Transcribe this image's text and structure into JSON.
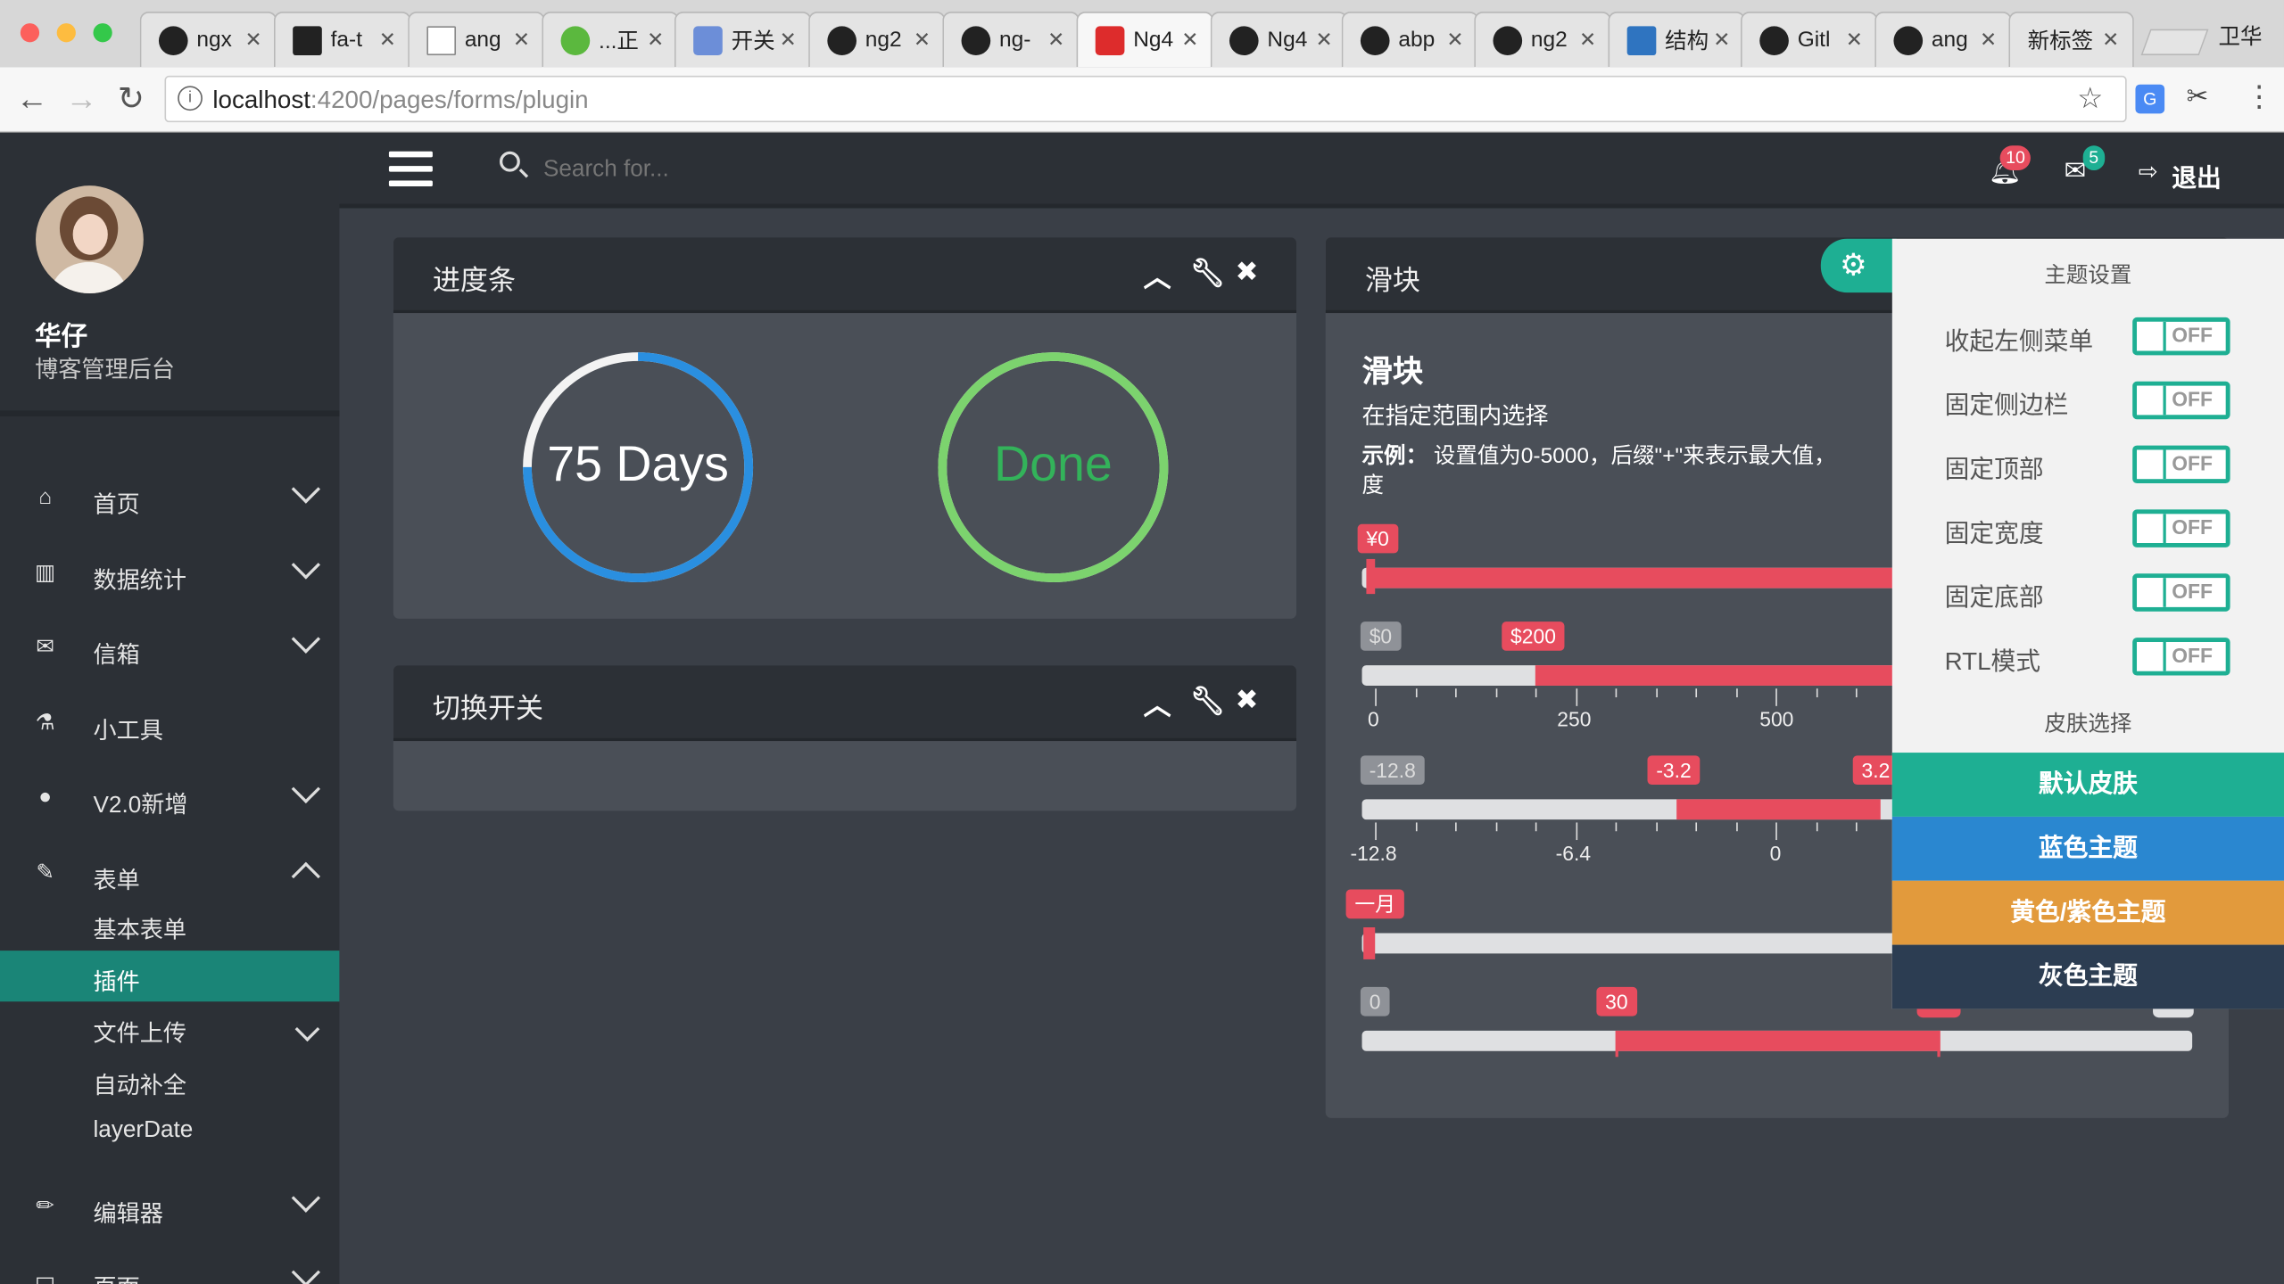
{
  "browser": {
    "tabs": [
      {
        "label": "ngx",
        "icon": "github-icon"
      },
      {
        "label": "fa-t",
        "icon": "flag-icon"
      },
      {
        "label": "ang",
        "icon": "document-icon"
      },
      {
        "label": "...正",
        "icon": "app-icon"
      },
      {
        "label": "开关",
        "icon": "shield-icon"
      },
      {
        "label": "ng2",
        "icon": "github-icon"
      },
      {
        "label": "ng-",
        "icon": "github-icon"
      },
      {
        "label": "Ng4",
        "icon": "angular-icon"
      },
      {
        "label": "Ng4",
        "icon": "github-icon"
      },
      {
        "label": "abp",
        "icon": "github-icon"
      },
      {
        "label": "ng2",
        "icon": "github-icon"
      },
      {
        "label": "结构",
        "icon": "typescript-icon"
      },
      {
        "label": "Gitl",
        "icon": "github-icon"
      },
      {
        "label": "ang",
        "icon": "github-icon"
      },
      {
        "label": "新标签",
        "icon": "none"
      }
    ],
    "profile": "卫华",
    "url_host": "localhost",
    "url_rest": ":4200/pages/forms/plugin"
  },
  "user": {
    "name": "华仔",
    "subtitle": "博客管理后台"
  },
  "search": {
    "placeholder": "Search for..."
  },
  "topbar": {
    "notifications": "10",
    "messages": "5",
    "logout": "退出"
  },
  "sidebar": {
    "items": [
      {
        "label": "首页",
        "icon": "home-icon"
      },
      {
        "label": "数据统计",
        "icon": "bar-chart-icon"
      },
      {
        "label": "信箱",
        "icon": "envelope-icon"
      },
      {
        "label": "小工具",
        "icon": "flask-icon"
      },
      {
        "label": "V2.0新增",
        "icon": "globe-icon"
      },
      {
        "label": "表单",
        "icon": "edit-icon"
      },
      {
        "label": "编辑器",
        "icon": "pencil-icon"
      },
      {
        "label": "页面",
        "icon": "monitor-icon"
      }
    ],
    "form_children": [
      "基本表单",
      "插件",
      "文件上传",
      "自动补全",
      "layerDate"
    ]
  },
  "panels": {
    "progress": {
      "title": "进度条",
      "circle1": "75 Days",
      "circle1_progress": 0.75,
      "circle2": "Done",
      "circle2_progress": 1.0
    },
    "toggle": {
      "title": "切换开关"
    },
    "slider": {
      "title": "滑块",
      "heading": "滑块",
      "desc": "在指定范围内选择",
      "example_label": "示例：",
      "example_text": "设置值为0-5000，后缀\"+\"来表示最大值，",
      "example_text2": "度",
      "s1": {
        "tag": "¥0"
      },
      "s2": {
        "min": "$0",
        "tag": "$200",
        "ticks": [
          "0",
          "250",
          "500"
        ]
      },
      "s3": {
        "min": "-12.8",
        "from": "-3.2",
        "to": "3.2",
        "ticks": [
          "-12.8",
          "-6.4",
          "0"
        ]
      },
      "s4": {
        "tag": "一月"
      },
      "s5": {
        "min": "0",
        "tag": "30"
      }
    }
  },
  "settings": {
    "title": "主题设置",
    "rows": [
      {
        "label": "收起左侧菜单",
        "value": "OFF"
      },
      {
        "label": "固定侧边栏",
        "value": "OFF"
      },
      {
        "label": "固定顶部",
        "value": "OFF"
      },
      {
        "label": "固定宽度",
        "value": "OFF"
      },
      {
        "label": "固定底部",
        "value": "OFF"
      },
      {
        "label": "RTL模式",
        "value": "OFF"
      }
    ],
    "skin_title": "皮肤选择",
    "skins": [
      {
        "label": "默认皮肤",
        "color": "#1eaf93"
      },
      {
        "label": "蓝色主题",
        "color": "#2a87d0"
      },
      {
        "label": "黄色/紫色主题",
        "color": "#e29a3c"
      },
      {
        "label": "灰色主题",
        "color": "#2c3d52"
      }
    ]
  },
  "colors": {
    "accent": "#1eaf93",
    "slider": "#e74c5e",
    "blue_ring": "#2a8fe0",
    "green_ring": "#7cd36e"
  }
}
